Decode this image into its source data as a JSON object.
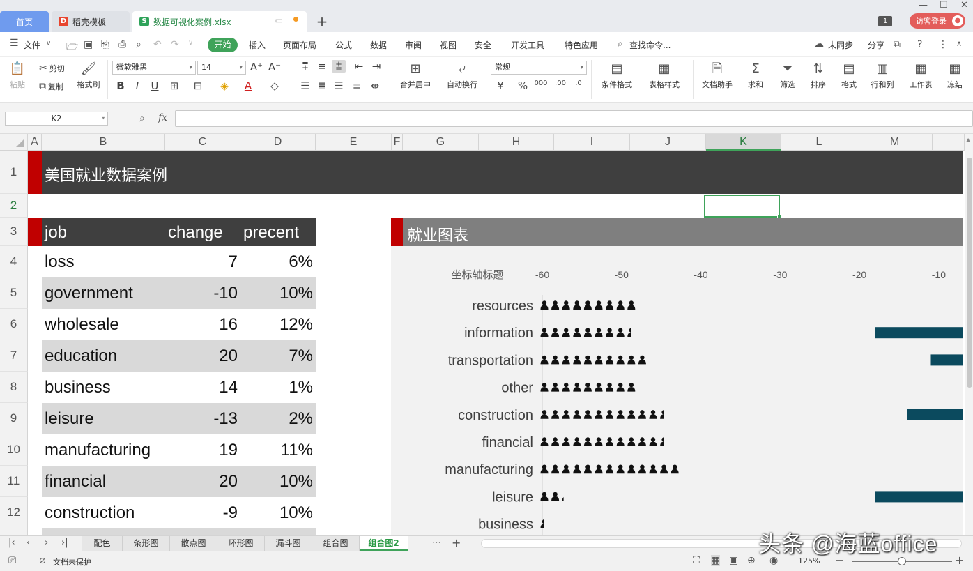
{
  "tabs": {
    "home": "首页",
    "template": "稻壳模板",
    "file": "数据可视化案例.xlsx",
    "visitor": "访客登录",
    "count": "1"
  },
  "menu": {
    "file": "文件",
    "start": "开始",
    "items": [
      "插入",
      "页面布局",
      "公式",
      "数据",
      "审阅",
      "视图",
      "安全",
      "开发工具",
      "特色应用"
    ],
    "search": "查找命令...",
    "sync": "未同步",
    "share": "分享"
  },
  "ribbon": {
    "paste": "粘贴",
    "cut": "剪切",
    "copy": "复制",
    "format_painter": "格式刷",
    "font_name": "微软雅黑",
    "font_size": "14",
    "merge_center": "合并居中",
    "wrap": "自动换行",
    "number_format": "常规",
    "cond_format": "条件格式",
    "table_style": "表格样式",
    "doc_helper": "文档助手",
    "sum": "求和",
    "filter": "筛选",
    "sort": "排序",
    "format": "格式",
    "row_col": "行和列",
    "sheet": "工作表",
    "freeze": "冻结"
  },
  "formula": {
    "cell_ref": "K2",
    "fx": "fx",
    "value": ""
  },
  "columns": [
    "A",
    "B",
    "C",
    "D",
    "E",
    "F",
    "G",
    "H",
    "I",
    "J",
    "K",
    "L",
    "M"
  ],
  "rows": [
    "1",
    "2",
    "3",
    "4",
    "5",
    "6",
    "7",
    "8",
    "9",
    "10",
    "11",
    "12"
  ],
  "sheet": {
    "title": "美国就业数据案例",
    "table_headers": {
      "job": "job",
      "change": "change",
      "percent": "precent"
    },
    "table_rows": [
      {
        "job": "loss",
        "change": "7",
        "percent": "6%"
      },
      {
        "job": "government",
        "change": "-10",
        "percent": "10%"
      },
      {
        "job": "wholesale",
        "change": "16",
        "percent": "12%"
      },
      {
        "job": "education",
        "change": "20",
        "percent": "7%"
      },
      {
        "job": "business",
        "change": "14",
        "percent": "1%"
      },
      {
        "job": "leisure",
        "change": "-13",
        "percent": "2%"
      },
      {
        "job": "manufacturing",
        "change": "19",
        "percent": "11%"
      },
      {
        "job": "financial",
        "change": "20",
        "percent": "10%"
      },
      {
        "job": "construction",
        "change": "-9",
        "percent": "10%"
      }
    ],
    "chart_title": "就业图表"
  },
  "chart_data": {
    "type": "bar",
    "orientation": "horizontal",
    "axis_title": "坐标轴标题",
    "xticks": [
      "-60",
      "-50",
      "-40",
      "-30",
      "-20",
      "-10"
    ],
    "xlim": [
      -60,
      -7
    ],
    "categories": [
      "resources",
      "information",
      "transportation",
      "other",
      "construction",
      "financial",
      "manufacturing",
      "leisure",
      "business"
    ],
    "icon_counts": [
      9,
      8.5,
      10,
      9,
      11.5,
      11.5,
      13,
      2.2,
      0.5
    ],
    "negative_bars": [
      null,
      -18,
      -11,
      null,
      -14,
      null,
      null,
      -18,
      null
    ],
    "bar_color": "#0b4a5e",
    "icon_color": "#111111"
  },
  "sheet_tabs": [
    "配色",
    "条形图",
    "散点图",
    "环形图",
    "漏斗图",
    "组合图",
    "组合图2"
  ],
  "active_sheet": "组合图2",
  "status": {
    "protect": "文档未保护",
    "zoom": "125%"
  },
  "watermark": "头条 @海蓝office",
  "colors": {
    "accent_red": "#c00000",
    "header_dark": "#3f3f3f",
    "chart_header": "#7f7f7f",
    "green": "#3fa35a"
  }
}
